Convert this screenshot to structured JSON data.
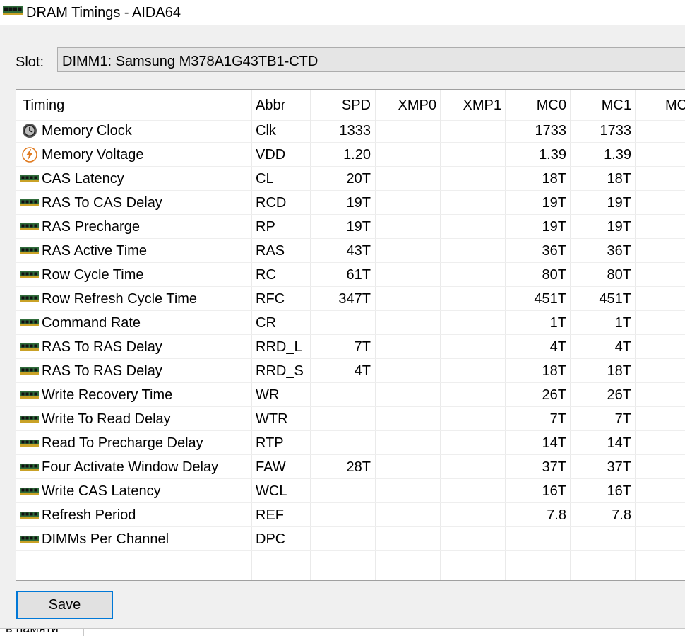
{
  "window": {
    "title": "DRAM Timings - AIDA64"
  },
  "slot": {
    "label": "Slot:",
    "value": "DIMM1: Samsung M378A1G43TB1-CTD"
  },
  "table": {
    "headers": [
      "Timing",
      "Abbr",
      "SPD",
      "XMP0",
      "XMP1",
      "MC0",
      "MC1",
      "MC"
    ],
    "rows": [
      {
        "icon": "clock-icon",
        "timing": "Memory Clock",
        "abbr": "Clk",
        "spd": "1333",
        "xmp0": "",
        "xmp1": "",
        "mc0": "1733",
        "mc1": "1733"
      },
      {
        "icon": "voltage-icon",
        "timing": "Memory Voltage",
        "abbr": "VDD",
        "spd": "1.20",
        "xmp0": "",
        "xmp1": "",
        "mc0": "1.39",
        "mc1": "1.39"
      },
      {
        "icon": "ram-icon",
        "timing": "CAS Latency",
        "abbr": "CL",
        "spd": "20T",
        "xmp0": "",
        "xmp1": "",
        "mc0": "18T",
        "mc1": "18T"
      },
      {
        "icon": "ram-icon",
        "timing": "RAS To CAS Delay",
        "abbr": "RCD",
        "spd": "19T",
        "xmp0": "",
        "xmp1": "",
        "mc0": "19T",
        "mc1": "19T"
      },
      {
        "icon": "ram-icon",
        "timing": "RAS Precharge",
        "abbr": "RP",
        "spd": "19T",
        "xmp0": "",
        "xmp1": "",
        "mc0": "19T",
        "mc1": "19T"
      },
      {
        "icon": "ram-icon",
        "timing": "RAS Active Time",
        "abbr": "RAS",
        "spd": "43T",
        "xmp0": "",
        "xmp1": "",
        "mc0": "36T",
        "mc1": "36T"
      },
      {
        "icon": "ram-icon",
        "timing": "Row Cycle Time",
        "abbr": "RC",
        "spd": "61T",
        "xmp0": "",
        "xmp1": "",
        "mc0": "80T",
        "mc1": "80T"
      },
      {
        "icon": "ram-icon",
        "timing": "Row Refresh Cycle Time",
        "abbr": "RFC",
        "spd": "347T",
        "xmp0": "",
        "xmp1": "",
        "mc0": "451T",
        "mc1": "451T"
      },
      {
        "icon": "ram-icon",
        "timing": "Command Rate",
        "abbr": "CR",
        "spd": "",
        "xmp0": "",
        "xmp1": "",
        "mc0": "1T",
        "mc1": "1T"
      },
      {
        "icon": "ram-icon",
        "timing": "RAS To RAS Delay",
        "abbr": "RRD_L",
        "spd": "7T",
        "xmp0": "",
        "xmp1": "",
        "mc0": "4T",
        "mc1": "4T"
      },
      {
        "icon": "ram-icon",
        "timing": "RAS To RAS Delay",
        "abbr": "RRD_S",
        "spd": "4T",
        "xmp0": "",
        "xmp1": "",
        "mc0": "18T",
        "mc1": "18T"
      },
      {
        "icon": "ram-icon",
        "timing": "Write Recovery Time",
        "abbr": "WR",
        "spd": "",
        "xmp0": "",
        "xmp1": "",
        "mc0": "26T",
        "mc1": "26T"
      },
      {
        "icon": "ram-icon",
        "timing": "Write To Read Delay",
        "abbr": "WTR",
        "spd": "",
        "xmp0": "",
        "xmp1": "",
        "mc0": "7T",
        "mc1": "7T"
      },
      {
        "icon": "ram-icon",
        "timing": "Read To Precharge Delay",
        "abbr": "RTP",
        "spd": "",
        "xmp0": "",
        "xmp1": "",
        "mc0": "14T",
        "mc1": "14T"
      },
      {
        "icon": "ram-icon",
        "timing": "Four Activate Window Delay",
        "abbr": "FAW",
        "spd": "28T",
        "xmp0": "",
        "xmp1": "",
        "mc0": "37T",
        "mc1": "37T"
      },
      {
        "icon": "ram-icon",
        "timing": "Write CAS Latency",
        "abbr": "WCL",
        "spd": "",
        "xmp0": "",
        "xmp1": "",
        "mc0": "16T",
        "mc1": "16T"
      },
      {
        "icon": "ram-icon",
        "timing": "Refresh Period",
        "abbr": "REF",
        "spd": "",
        "xmp0": "",
        "xmp1": "",
        "mc0": "7.8",
        "mc1": "7.8"
      },
      {
        "icon": "ram-icon",
        "timing": "DIMMs Per Channel",
        "abbr": "DPC",
        "spd": "",
        "xmp0": "",
        "xmp1": "",
        "mc0": "",
        "mc1": ""
      }
    ]
  },
  "buttons": {
    "save": "Save"
  },
  "background_text": "в памяти",
  "colors": {
    "focus_border": "#0078d7",
    "ram_chip": "#2f6b3a",
    "ram_contacts": "#c9a227"
  }
}
